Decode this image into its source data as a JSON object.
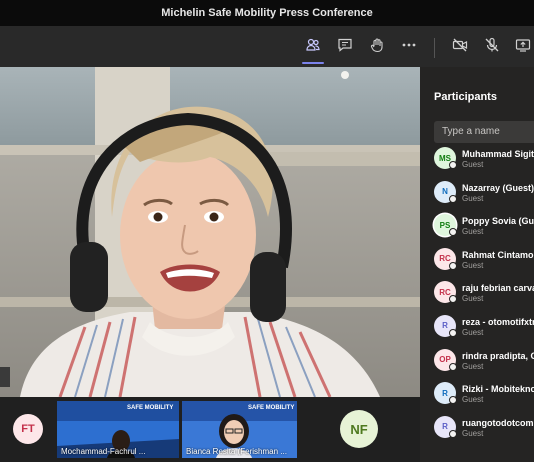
{
  "window": {
    "title": "Michelin Safe Mobility Press Conference"
  },
  "toolbar": {
    "buttons": [
      {
        "name": "participants-icon"
      },
      {
        "name": "chat-icon"
      },
      {
        "name": "raise-hand-icon"
      },
      {
        "name": "more-options-icon"
      },
      {
        "name": "camera-off-icon"
      },
      {
        "name": "mic-off-icon"
      },
      {
        "name": "share-screen-icon"
      }
    ]
  },
  "strip": {
    "ft_initials": "FT",
    "tile2_label": "Mochammad-Fachrul ...",
    "tile3_label": "Bianca Resita (Ferishman ...",
    "nf_initials": "NF",
    "banner_text": "SAFE MOBILITY"
  },
  "participants": {
    "title": "Participants",
    "search_placeholder": "Type a name",
    "partial_top": "(partially hidden) ...",
    "items": [
      {
        "initials": "MS",
        "name": "Muhammad Sigit",
        "role": "Guest",
        "bg": "#dff6dd",
        "fg": "#107c10"
      },
      {
        "initials": "N",
        "name": "Nazarray (Guest)",
        "role": "Guest",
        "bg": "#deecf9",
        "fg": "#0f6cbd"
      },
      {
        "initials": "PS",
        "name": "Poppy Sovia (Gu",
        "role": "Guest",
        "bg": "#dff6dd",
        "fg": "#107c10",
        "bold": true
      },
      {
        "initials": "RC",
        "name": "Rahmat Cintamob",
        "role": "Guest",
        "bg": "#fde7e9",
        "fg": "#c4314b"
      },
      {
        "initials": "RC",
        "name": "raju febrian carva",
        "role": "Guest",
        "bg": "#fde7e9",
        "fg": "#c4314b"
      },
      {
        "initials": "R",
        "name": "reza - otomotifxtr",
        "role": "Guest",
        "bg": "#e8e6f9",
        "fg": "#5b5fc7"
      },
      {
        "initials": "OP",
        "name": "rindra pradipta, C",
        "role": "Guest",
        "bg": "#fde7e9",
        "fg": "#c4314b"
      },
      {
        "initials": "R",
        "name": "Rizki - Mobitekno",
        "role": "Guest",
        "bg": "#deecf9",
        "fg": "#0f6cbd"
      },
      {
        "initials": "R",
        "name": "ruangotodotcom",
        "role": "Guest",
        "bg": "#e8e6f9",
        "fg": "#5b5fc7"
      }
    ]
  }
}
